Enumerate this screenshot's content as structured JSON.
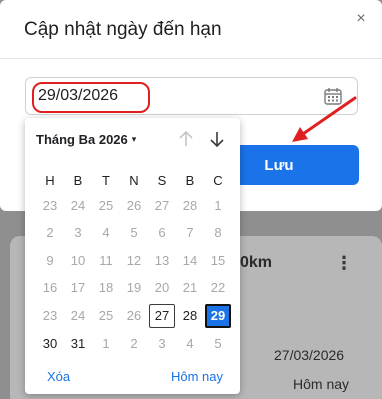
{
  "background": {
    "card_title_fragment": "0km",
    "kebab": "⋮",
    "date_text": "27/03/2026",
    "today_text": "Hôm nay"
  },
  "modal": {
    "title": "Cập nhật ngày đến hạn",
    "close_glyph": "×",
    "date_value": "29/03/2026",
    "save_label": "Lưu"
  },
  "picker": {
    "month_label": "Tháng Ba 2026",
    "caret": "▾",
    "weekdays": [
      "H",
      "B",
      "T",
      "N",
      "S",
      "B",
      "C"
    ],
    "weeks": [
      [
        "23",
        "24",
        "25",
        "26",
        "27",
        "28",
        "1"
      ],
      [
        "2",
        "3",
        "4",
        "5",
        "6",
        "7",
        "8"
      ],
      [
        "9",
        "10",
        "11",
        "12",
        "13",
        "14",
        "15"
      ],
      [
        "16",
        "17",
        "18",
        "19",
        "20",
        "21",
        "22"
      ],
      [
        "23",
        "24",
        "25",
        "26",
        "27",
        "28",
        "29"
      ],
      [
        "30",
        "31",
        "1",
        "2",
        "3",
        "4",
        "5"
      ]
    ],
    "current_month_mask": [
      [
        false,
        false,
        false,
        false,
        false,
        false,
        false
      ],
      [
        false,
        false,
        false,
        false,
        false,
        false,
        false
      ],
      [
        false,
        false,
        false,
        false,
        false,
        false,
        false
      ],
      [
        false,
        false,
        false,
        false,
        false,
        false,
        false
      ],
      [
        false,
        false,
        false,
        false,
        true,
        true,
        true
      ],
      [
        true,
        true,
        false,
        false,
        false,
        false,
        false
      ]
    ],
    "today": "27",
    "selected": "29",
    "clear_label": "Xóa",
    "today_label": "Hôm nay"
  },
  "colors": {
    "accent": "#1a73e8",
    "annotation": "#e02020"
  },
  "icons": {
    "calendar": "calendar-icon",
    "close": "close-icon",
    "nav_up": "arrow-up-icon",
    "nav_down": "arrow-down-icon"
  }
}
